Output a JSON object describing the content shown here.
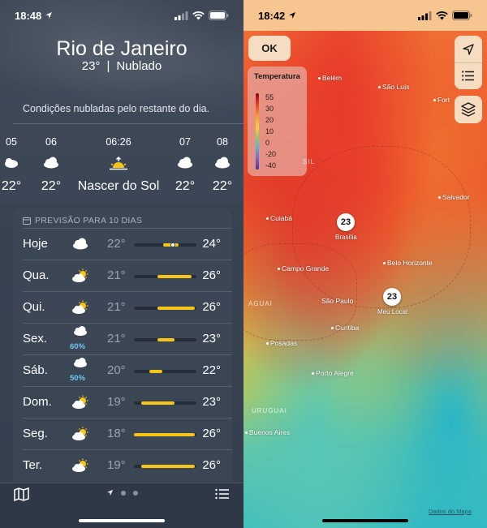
{
  "left": {
    "status": {
      "time": "18:48"
    },
    "location": {
      "city": "Rio de Janeiro",
      "temperature": "23°",
      "separator": "|",
      "condition": "Nublado"
    },
    "summary": "Condições nubladas pelo restante do dia.",
    "hourly": [
      {
        "time": "05",
        "icon": "partly-cloudy-icon",
        "temp": "22°"
      },
      {
        "time": "06",
        "icon": "cloud-icon",
        "temp": "22°"
      },
      {
        "time": "06:26",
        "icon": "sunrise-icon",
        "temp": "Nascer do Sol"
      },
      {
        "time": "07",
        "icon": "cloud-icon",
        "temp": "22°"
      },
      {
        "time": "08",
        "icon": "cloud-icon",
        "temp": "22°"
      }
    ],
    "forecast": {
      "header": "PREVISÃO PARA 10 DIAS",
      "days": [
        {
          "day": "Hoje",
          "icon": "cloud-icon",
          "low": "22°",
          "high": "24°",
          "range_start": 0.47,
          "range_end": 0.72,
          "precip": ""
        },
        {
          "day": "Qua.",
          "icon": "partly-sunny-icon",
          "low": "21°",
          "high": "26°",
          "range_start": 0.38,
          "range_end": 0.92,
          "precip": ""
        },
        {
          "day": "Qui.",
          "icon": "partly-sunny-icon",
          "low": "21°",
          "high": "26°",
          "range_start": 0.38,
          "range_end": 0.98,
          "precip": ""
        },
        {
          "day": "Sex.",
          "icon": "rain-icon",
          "low": "21°",
          "high": "23°",
          "range_start": 0.38,
          "range_end": 0.65,
          "precip": "60%"
        },
        {
          "day": "Sáb.",
          "icon": "rain-icon",
          "low": "20°",
          "high": "22°",
          "range_start": 0.25,
          "range_end": 0.45,
          "precip": "50%"
        },
        {
          "day": "Dom.",
          "icon": "partly-sunny-icon",
          "low": "19°",
          "high": "23°",
          "range_start": 0.12,
          "range_end": 0.65,
          "precip": ""
        },
        {
          "day": "Seg.",
          "icon": "partly-sunny-icon",
          "low": "18°",
          "high": "26°",
          "range_start": 0.0,
          "range_end": 0.98,
          "precip": ""
        },
        {
          "day": "Ter.",
          "icon": "partly-sunny-icon",
          "low": "19°",
          "high": "26°",
          "range_start": 0.12,
          "range_end": 0.98,
          "precip": ""
        }
      ]
    },
    "bottom": {
      "map_icon": "map-icon",
      "list_icon": "list-icon",
      "location_arrow": "location-arrow-icon"
    }
  },
  "right": {
    "status": {
      "time": "18:42"
    },
    "ok_label": "OK",
    "legend": {
      "title": "Temperatura",
      "ticks": [
        "55",
        "30",
        "20",
        "10",
        "0",
        "-20",
        "-40"
      ]
    },
    "cities": [
      {
        "name": "Belém"
      },
      {
        "name": "São Luís"
      },
      {
        "name": "Fort"
      },
      {
        "name": "Salvador"
      },
      {
        "name": "Cuiabá"
      },
      {
        "name": "Campo Grande"
      },
      {
        "name": "Belo Horizonte"
      },
      {
        "name": "São Paulo"
      },
      {
        "name": "Curitiba"
      },
      {
        "name": "Posadas"
      },
      {
        "name": "Porto Alegre"
      },
      {
        "name": "Buenos Aires"
      }
    ],
    "countries": [
      "SIL",
      "AGUAI",
      "URUGUAI"
    ],
    "pins": [
      {
        "value": "23",
        "label": "Brasília"
      },
      {
        "value": "23",
        "label": "Meu Local"
      }
    ],
    "credit": "Dados do Mapa"
  }
}
